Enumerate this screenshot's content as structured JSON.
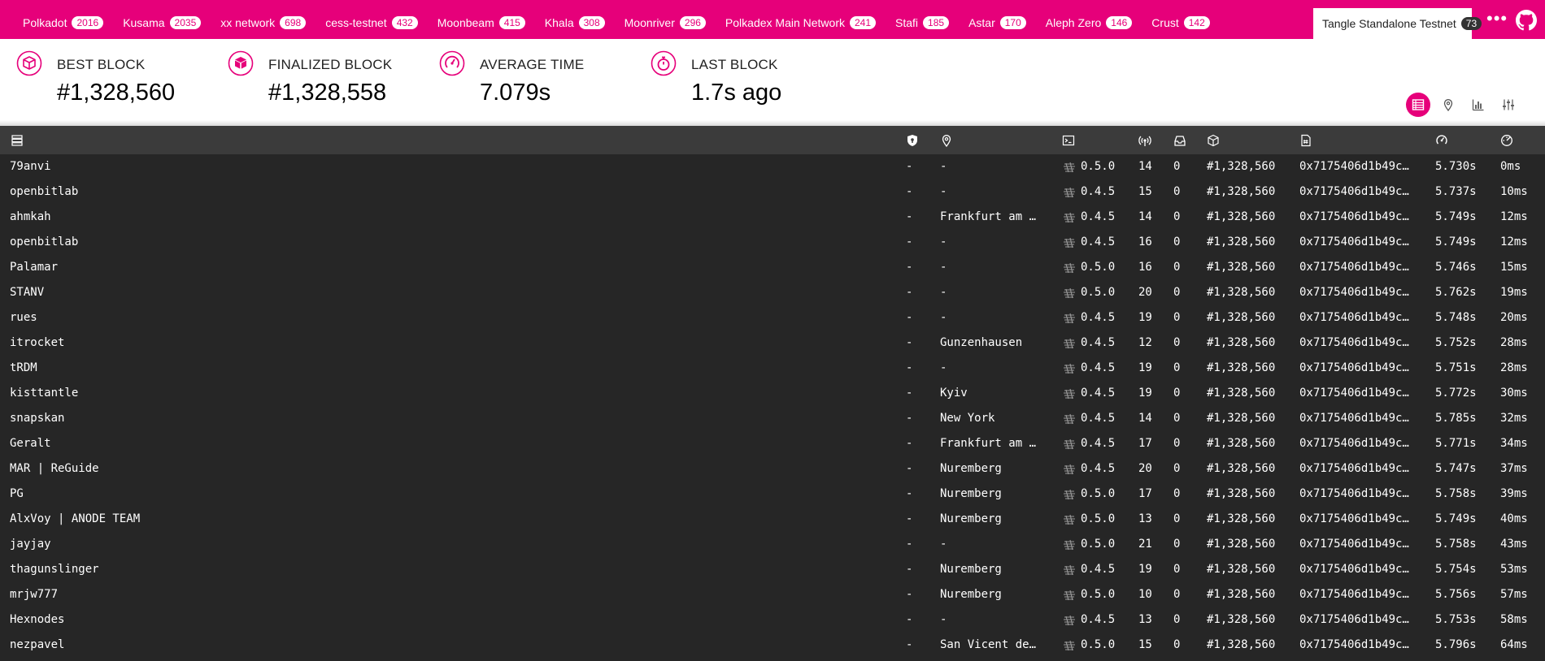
{
  "colors": {
    "accent": "#e6007a",
    "table_bg": "#262626",
    "table_header_bg": "#3b3b3b"
  },
  "chains": [
    {
      "name": "Polkadot",
      "count": "2016"
    },
    {
      "name": "Kusama",
      "count": "2035"
    },
    {
      "name": "xx network",
      "count": "698"
    },
    {
      "name": "cess-testnet",
      "count": "432"
    },
    {
      "name": "Moonbeam",
      "count": "415"
    },
    {
      "name": "Khala",
      "count": "308"
    },
    {
      "name": "Moonriver",
      "count": "296"
    },
    {
      "name": "Polkadex Main Network",
      "count": "241"
    },
    {
      "name": "Stafi",
      "count": "185"
    },
    {
      "name": "Astar",
      "count": "170"
    },
    {
      "name": "Aleph Zero",
      "count": "146"
    },
    {
      "name": "Crust",
      "count": "142"
    }
  ],
  "active_chain": {
    "name": "Tangle Standalone Testnet",
    "count": "73"
  },
  "stats": {
    "best_block": {
      "label": "BEST BLOCK",
      "value": "#1,328,560",
      "icon": "cube-icon"
    },
    "finalized_block": {
      "label": "FINALIZED BLOCK",
      "value": "#1,328,558",
      "icon": "cube-filled-icon"
    },
    "average_time": {
      "label": "AVERAGE TIME",
      "value": "7.079s",
      "icon": "timer-icon"
    },
    "last_block": {
      "label": "LAST BLOCK",
      "value": "1.7s ago",
      "icon": "stopwatch-icon"
    }
  },
  "view_buttons": [
    "list-view-icon",
    "map-view-icon",
    "stats-view-icon",
    "settings-icon"
  ],
  "table_headers": [
    "node-name-icon",
    "validator-icon",
    "location-icon",
    "implementation-icon",
    "peers-icon",
    "transactions-icon",
    "block-icon",
    "block-hash-icon",
    "finalized-icon",
    "propagation-icon"
  ],
  "rows": [
    {
      "name": "79anvi",
      "validator": "-",
      "location": "-",
      "version": "0.5.0",
      "peers": "14",
      "txs": "0",
      "block": "#1,328,560",
      "hash": "0x7175406d1b49c…",
      "finalized": "5.730s",
      "propagation": "0ms"
    },
    {
      "name": "openbitlab",
      "validator": "-",
      "location": "-",
      "version": "0.4.5",
      "peers": "15",
      "txs": "0",
      "block": "#1,328,560",
      "hash": "0x7175406d1b49c…",
      "finalized": "5.737s",
      "propagation": "10ms"
    },
    {
      "name": "ahmkah",
      "validator": "-",
      "location": "Frankfurt am …",
      "version": "0.4.5",
      "peers": "14",
      "txs": "0",
      "block": "#1,328,560",
      "hash": "0x7175406d1b49c…",
      "finalized": "5.749s",
      "propagation": "12ms"
    },
    {
      "name": "openbitlab",
      "validator": "-",
      "location": "-",
      "version": "0.4.5",
      "peers": "16",
      "txs": "0",
      "block": "#1,328,560",
      "hash": "0x7175406d1b49c…",
      "finalized": "5.749s",
      "propagation": "12ms"
    },
    {
      "name": "Palamar",
      "validator": "-",
      "location": "-",
      "version": "0.5.0",
      "peers": "16",
      "txs": "0",
      "block": "#1,328,560",
      "hash": "0x7175406d1b49c…",
      "finalized": "5.746s",
      "propagation": "15ms"
    },
    {
      "name": "STANV",
      "validator": "-",
      "location": "-",
      "version": "0.5.0",
      "peers": "20",
      "txs": "0",
      "block": "#1,328,560",
      "hash": "0x7175406d1b49c…",
      "finalized": "5.762s",
      "propagation": "19ms"
    },
    {
      "name": "rues",
      "validator": "-",
      "location": "-",
      "version": "0.4.5",
      "peers": "19",
      "txs": "0",
      "block": "#1,328,560",
      "hash": "0x7175406d1b49c…",
      "finalized": "5.748s",
      "propagation": "20ms"
    },
    {
      "name": "itrocket",
      "validator": "-",
      "location": "Gunzenhausen",
      "version": "0.4.5",
      "peers": "12",
      "txs": "0",
      "block": "#1,328,560",
      "hash": "0x7175406d1b49c…",
      "finalized": "5.752s",
      "propagation": "28ms"
    },
    {
      "name": "tRDM",
      "validator": "-",
      "location": "-",
      "version": "0.4.5",
      "peers": "19",
      "txs": "0",
      "block": "#1,328,560",
      "hash": "0x7175406d1b49c…",
      "finalized": "5.751s",
      "propagation": "28ms"
    },
    {
      "name": "kisttantle",
      "validator": "-",
      "location": "Kyiv",
      "version": "0.4.5",
      "peers": "19",
      "txs": "0",
      "block": "#1,328,560",
      "hash": "0x7175406d1b49c…",
      "finalized": "5.772s",
      "propagation": "30ms"
    },
    {
      "name": "snapskan",
      "validator": "-",
      "location": "New York",
      "version": "0.4.5",
      "peers": "14",
      "txs": "0",
      "block": "#1,328,560",
      "hash": "0x7175406d1b49c…",
      "finalized": "5.785s",
      "propagation": "32ms"
    },
    {
      "name": "Geralt",
      "validator": "-",
      "location": "Frankfurt am …",
      "version": "0.4.5",
      "peers": "17",
      "txs": "0",
      "block": "#1,328,560",
      "hash": "0x7175406d1b49c…",
      "finalized": "5.771s",
      "propagation": "34ms"
    },
    {
      "name": "MAR | ReGuide",
      "validator": "-",
      "location": "Nuremberg",
      "version": "0.4.5",
      "peers": "20",
      "txs": "0",
      "block": "#1,328,560",
      "hash": "0x7175406d1b49c…",
      "finalized": "5.747s",
      "propagation": "37ms"
    },
    {
      "name": "PG",
      "validator": "-",
      "location": "Nuremberg",
      "version": "0.5.0",
      "peers": "17",
      "txs": "0",
      "block": "#1,328,560",
      "hash": "0x7175406d1b49c…",
      "finalized": "5.758s",
      "propagation": "39ms"
    },
    {
      "name": "AlxVoy | ANODE TEAM",
      "validator": "-",
      "location": "Nuremberg",
      "version": "0.5.0",
      "peers": "13",
      "txs": "0",
      "block": "#1,328,560",
      "hash": "0x7175406d1b49c…",
      "finalized": "5.749s",
      "propagation": "40ms"
    },
    {
      "name": "jayjay",
      "validator": "-",
      "location": "-",
      "version": "0.5.0",
      "peers": "21",
      "txs": "0",
      "block": "#1,328,560",
      "hash": "0x7175406d1b49c…",
      "finalized": "5.758s",
      "propagation": "43ms"
    },
    {
      "name": "thagunslinger",
      "validator": "-",
      "location": "Nuremberg",
      "version": "0.4.5",
      "peers": "19",
      "txs": "0",
      "block": "#1,328,560",
      "hash": "0x7175406d1b49c…",
      "finalized": "5.754s",
      "propagation": "53ms"
    },
    {
      "name": "mrjw777",
      "validator": "-",
      "location": "Nuremberg",
      "version": "0.5.0",
      "peers": "10",
      "txs": "0",
      "block": "#1,328,560",
      "hash": "0x7175406d1b49c…",
      "finalized": "5.756s",
      "propagation": "57ms"
    },
    {
      "name": "Hexnodes",
      "validator": "-",
      "location": "-",
      "version": "0.4.5",
      "peers": "13",
      "txs": "0",
      "block": "#1,328,560",
      "hash": "0x7175406d1b49c…",
      "finalized": "5.753s",
      "propagation": "58ms"
    },
    {
      "name": "nezpavel",
      "validator": "-",
      "location": "San Vicent de…",
      "version": "0.5.0",
      "peers": "15",
      "txs": "0",
      "block": "#1,328,560",
      "hash": "0x7175406d1b49c…",
      "finalized": "5.796s",
      "propagation": "64ms"
    }
  ]
}
